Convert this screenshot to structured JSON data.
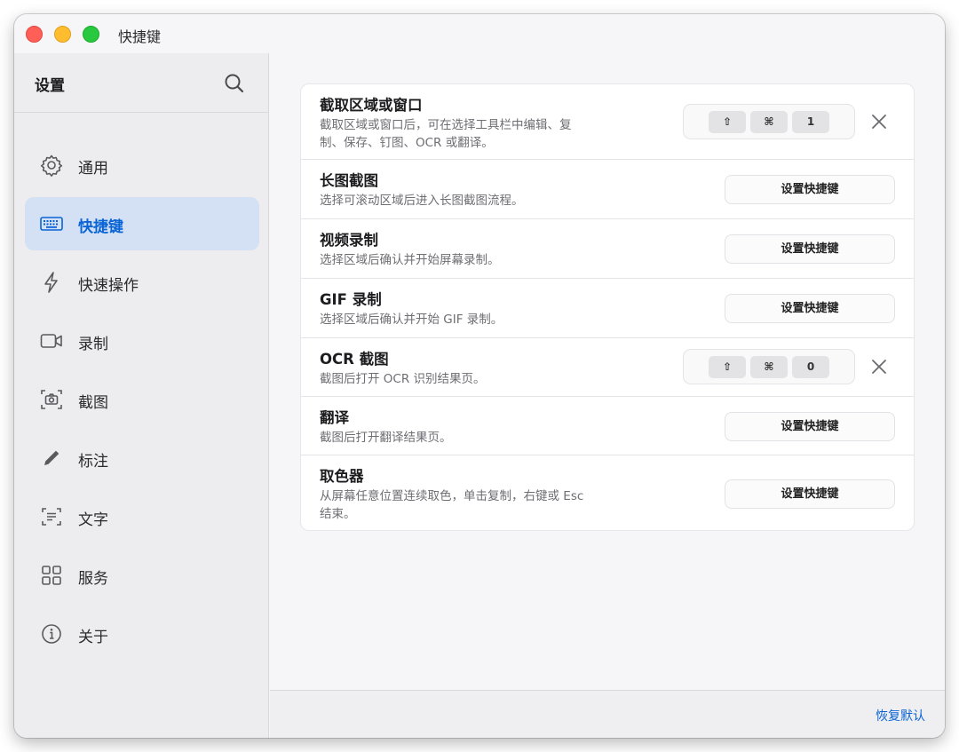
{
  "window": {
    "title": "快捷键"
  },
  "sidebar": {
    "title": "设置",
    "items": [
      {
        "label": "通用",
        "icon": "gear-icon"
      },
      {
        "label": "快捷键",
        "icon": "keyboard-icon",
        "active": true
      },
      {
        "label": "快速操作",
        "icon": "bolt-icon"
      },
      {
        "label": "录制",
        "icon": "video-camera-icon"
      },
      {
        "label": "截图",
        "icon": "screenshot-camera-icon"
      },
      {
        "label": "标注",
        "icon": "pencil-icon"
      },
      {
        "label": "文字",
        "icon": "text-scan-icon"
      },
      {
        "label": "服务",
        "icon": "grid-icon"
      },
      {
        "label": "关于",
        "icon": "info-icon"
      }
    ]
  },
  "shortcuts": [
    {
      "title": "截取区域或窗口",
      "desc": "截取区域或窗口后，可在选择工具栏中编辑、复制、保存、钉图、OCR 或翻译。",
      "keys": [
        "⇧",
        "⌘",
        "1"
      ]
    },
    {
      "title": "长图截图",
      "desc": "选择可滚动区域后进入长图截图流程。",
      "button": "设置快捷键"
    },
    {
      "title": "视频录制",
      "desc": "选择区域后确认并开始屏幕录制。",
      "button": "设置快捷键"
    },
    {
      "title": "GIF 录制",
      "desc": "选择区域后确认并开始 GIF 录制。",
      "button": "设置快捷键"
    },
    {
      "title": "OCR 截图",
      "desc": "截图后打开 OCR 识别结果页。",
      "keys": [
        "⇧",
        "⌘",
        "0"
      ]
    },
    {
      "title": "翻译",
      "desc": "截图后打开翻译结果页。",
      "button": "设置快捷键"
    },
    {
      "title": "取色器",
      "desc": "从屏幕任意位置连续取色，单击复制，右键或 Esc 结束。",
      "button": "设置快捷键"
    }
  ],
  "footer": {
    "restore_label": "恢复默认"
  },
  "colors": {
    "accent": "#0a64d6",
    "active_bg": "#d4e1f4"
  }
}
